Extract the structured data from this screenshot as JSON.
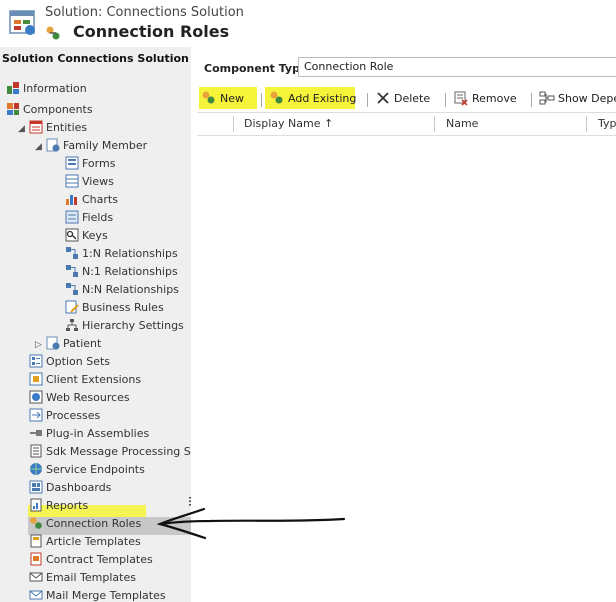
{
  "header": {
    "solution_label": "Solution: Connections Solution",
    "page_title": "Connection Roles"
  },
  "sidebar": {
    "title": "Solution Connections Solution",
    "items": [
      {
        "label": "Information",
        "icon": "information-icon"
      },
      {
        "label": "Components",
        "icon": "components-icon"
      },
      {
        "label": "Entities",
        "icon": "entities-icon"
      },
      {
        "label": "Family Member",
        "icon": "entity-icon"
      },
      {
        "label": "Forms",
        "icon": "forms-icon"
      },
      {
        "label": "Views",
        "icon": "views-icon"
      },
      {
        "label": "Charts",
        "icon": "charts-icon"
      },
      {
        "label": "Fields",
        "icon": "fields-icon"
      },
      {
        "label": "Keys",
        "icon": "keys-icon"
      },
      {
        "label": "1:N Relationships",
        "icon": "relationship-icon"
      },
      {
        "label": "N:1 Relationships",
        "icon": "relationship-icon"
      },
      {
        "label": "N:N Relationships",
        "icon": "relationship-icon"
      },
      {
        "label": "Business Rules",
        "icon": "business-rules-icon"
      },
      {
        "label": "Hierarchy Settings",
        "icon": "hierarchy-icon"
      },
      {
        "label": "Patient",
        "icon": "entity-icon"
      },
      {
        "label": "Option Sets",
        "icon": "option-sets-icon"
      },
      {
        "label": "Client Extensions",
        "icon": "client-extensions-icon"
      },
      {
        "label": "Web Resources",
        "icon": "web-resources-icon"
      },
      {
        "label": "Processes",
        "icon": "processes-icon"
      },
      {
        "label": "Plug-in Assemblies",
        "icon": "plugin-icon"
      },
      {
        "label": "Sdk Message Processing St...",
        "icon": "sdk-message-icon"
      },
      {
        "label": "Service Endpoints",
        "icon": "service-endpoints-icon"
      },
      {
        "label": "Dashboards",
        "icon": "dashboards-icon"
      },
      {
        "label": "Reports",
        "icon": "reports-icon"
      },
      {
        "label": "Connection Roles",
        "icon": "connection-roles-icon"
      },
      {
        "label": "Article Templates",
        "icon": "article-templates-icon"
      },
      {
        "label": "Contract Templates",
        "icon": "contract-templates-icon"
      },
      {
        "label": "Email Templates",
        "icon": "email-templates-icon"
      },
      {
        "label": "Mail Merge Templates",
        "icon": "mail-merge-icon"
      }
    ]
  },
  "main": {
    "component_type_label": "Component Type",
    "component_type_value": "Connection Role",
    "toolbar": {
      "new": "New",
      "add_existing": "Add Existing",
      "delete": "Delete",
      "remove": "Remove",
      "show_dependencies": "Show Depe"
    },
    "columns": {
      "display_name": "Display Name",
      "name": "Name",
      "type": "Type"
    }
  },
  "colors": {
    "highlight": "#f6f43a",
    "sidebar_bg": "#efefef",
    "selection_bg": "#c8c8c8"
  }
}
